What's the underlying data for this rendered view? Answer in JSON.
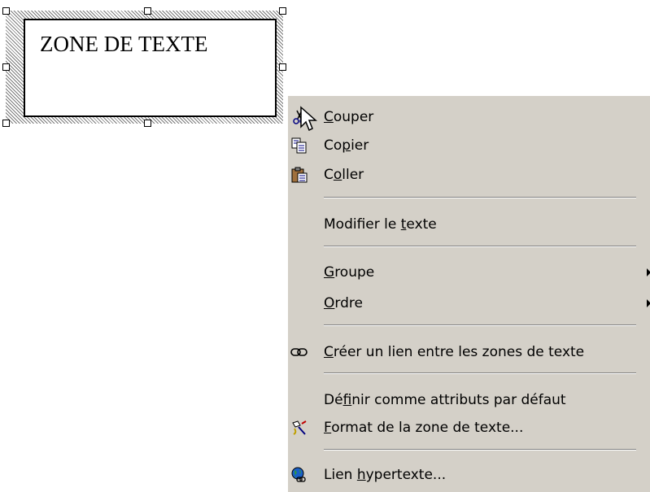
{
  "textbox": {
    "text": "ZONE DE TEXTE"
  },
  "menu": {
    "items": [
      {
        "before": "",
        "accel": "C",
        "after": "ouper",
        "icon": "scissors-icon"
      },
      {
        "before": "Co",
        "accel": "p",
        "after": "ier",
        "icon": "copy-icon"
      },
      {
        "before": "C",
        "accel": "o",
        "after": "ller",
        "icon": "paste-icon"
      },
      {
        "before": "Modifier le ",
        "accel": "t",
        "after": "exte",
        "icon": ""
      },
      {
        "before": "",
        "accel": "G",
        "after": "roupe",
        "icon": "",
        "submenu": true
      },
      {
        "before": "",
        "accel": "O",
        "after": "rdre",
        "icon": "",
        "submenu": true
      },
      {
        "before": "",
        "accel": "C",
        "after": "réer un lien entre les zones de texte",
        "icon": "chain-link-icon"
      },
      {
        "before": "Dé",
        "accel": "f",
        "after": "inir comme attributs par défaut",
        "icon": ""
      },
      {
        "before": "",
        "accel": "F",
        "after": "ormat de la zone de texte...",
        "icon": "format-painter-icon"
      },
      {
        "before": "Lien ",
        "accel": "h",
        "after": "ypertexte...",
        "icon": "hyperlink-globe-icon"
      }
    ]
  }
}
